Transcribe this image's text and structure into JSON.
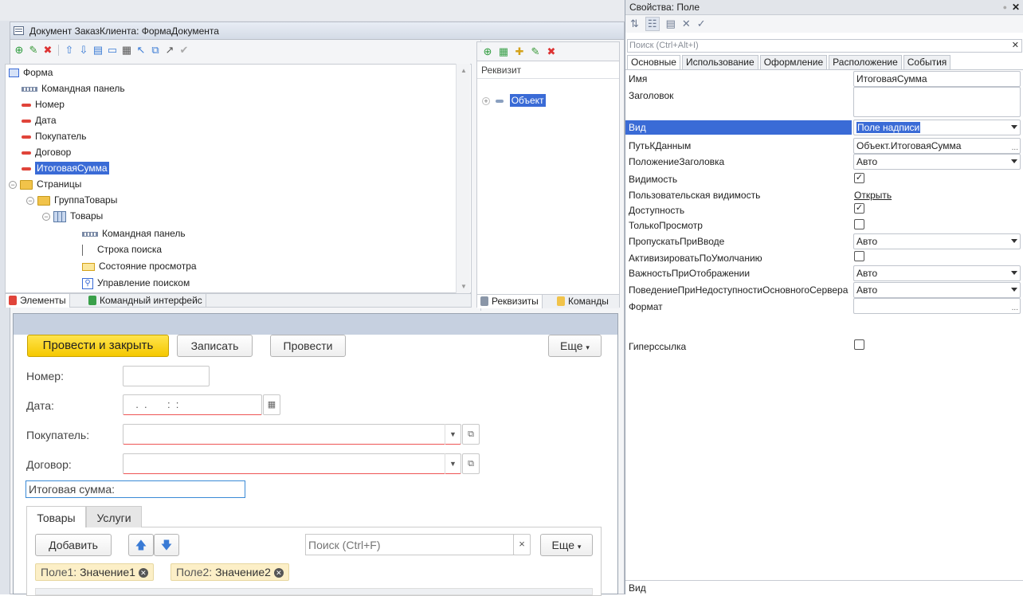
{
  "window": {
    "title": "Документ ЗаказКлиента: ФормаДокумента"
  },
  "tree": {
    "items": [
      {
        "label": "Форма"
      },
      {
        "label": "Командная панель"
      },
      {
        "label": "Номер"
      },
      {
        "label": "Дата"
      },
      {
        "label": "Покупатель"
      },
      {
        "label": "Договор"
      },
      {
        "label": "ИтоговаяСумма"
      },
      {
        "label": "Страницы"
      },
      {
        "label": "ГруппаТовары"
      },
      {
        "label": "Товары"
      },
      {
        "label": "Командная панель"
      },
      {
        "label": "Строка поиска"
      },
      {
        "label": "Состояние просмотра"
      },
      {
        "label": "Управление поиском"
      }
    ],
    "tabs": [
      "Элементы",
      "Командный интерфейс"
    ]
  },
  "requisites": {
    "column": "Реквизит",
    "item": "Объект",
    "tabs": [
      "Реквизиты",
      "Команды"
    ]
  },
  "form": {
    "buttons": {
      "post_close": "Провести и закрыть",
      "write": "Записать",
      "post": "Провести",
      "more": "Еще"
    },
    "fields": {
      "number_label": "Номер:",
      "date_label": "Дата:",
      "date_value": "  .  .       :  :",
      "buyer_label": "Покупатель:",
      "contract_label": "Договор:",
      "total_label": "Итоговая сумма:"
    },
    "tabs": [
      "Товары",
      "Услуги"
    ],
    "table_toolbar": {
      "add": "Добавить",
      "search_placeholder": "Поиск (Ctrl+F)",
      "clear": "×",
      "more": "Еще"
    },
    "filters": [
      {
        "field": "Поле1:",
        "value": "Значение1"
      },
      {
        "field": "Поле2:",
        "value": "Значение2"
      }
    ]
  },
  "properties": {
    "title": "Свойства: Поле",
    "search_placeholder": "Поиск (Ctrl+Alt+I)",
    "tabs": [
      "Основные",
      "Использование",
      "Оформление",
      "Расположение",
      "События"
    ],
    "rows": {
      "name": {
        "label": "Имя",
        "value": "ИтоговаяСумма"
      },
      "caption": {
        "label": "Заголовок",
        "value": ""
      },
      "kind": {
        "label": "Вид",
        "value": "Поле надписи"
      },
      "datapath": {
        "label": "ПутьКДанным",
        "value": "Объект.ИтоговаяСумма"
      },
      "titlepos": {
        "label": "ПоложениеЗаголовка",
        "value": "Авто"
      },
      "visible": {
        "label": "Видимость",
        "checked": true
      },
      "uservis": {
        "label": "Пользовательская видимость",
        "value": "Открыть"
      },
      "enabled": {
        "label": "Доступность",
        "checked": true
      },
      "readonly": {
        "label": "ТолькоПросмотр",
        "checked": false
      },
      "skip": {
        "label": "ПропускатьПриВводе",
        "value": "Авто"
      },
      "activate": {
        "label": "АктивизироватьПоУмолчанию",
        "checked": false
      },
      "importance": {
        "label": "ВажностьПриОтображении",
        "value": "Авто"
      },
      "behavior": {
        "label": "ПоведениеПриНедоступностиОсновногоСервера",
        "value": "Авто"
      },
      "format": {
        "label": "Формат",
        "value": ""
      },
      "hyperlink": {
        "label": "Гиперссылка",
        "checked": false
      }
    },
    "footer": "Вид"
  }
}
